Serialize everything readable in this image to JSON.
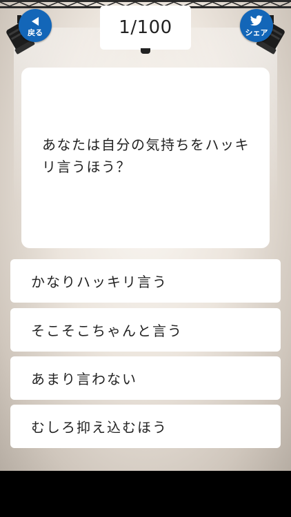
{
  "header": {
    "back_label": "戻る",
    "back_icon": "triangle-left-icon",
    "share_label": "シェア",
    "share_icon": "twitter-bird-icon",
    "counter": "1/100",
    "button_color": "#1366b8"
  },
  "question": {
    "text": "あなたは自分の気持ちをハッキリ言うほう？"
  },
  "answers": [
    {
      "label": "かなりハッキリ言う"
    },
    {
      "label": "そこそこちゃんと言う"
    },
    {
      "label": "あまり言わない"
    },
    {
      "label": "むしろ抑え込むほう"
    }
  ]
}
